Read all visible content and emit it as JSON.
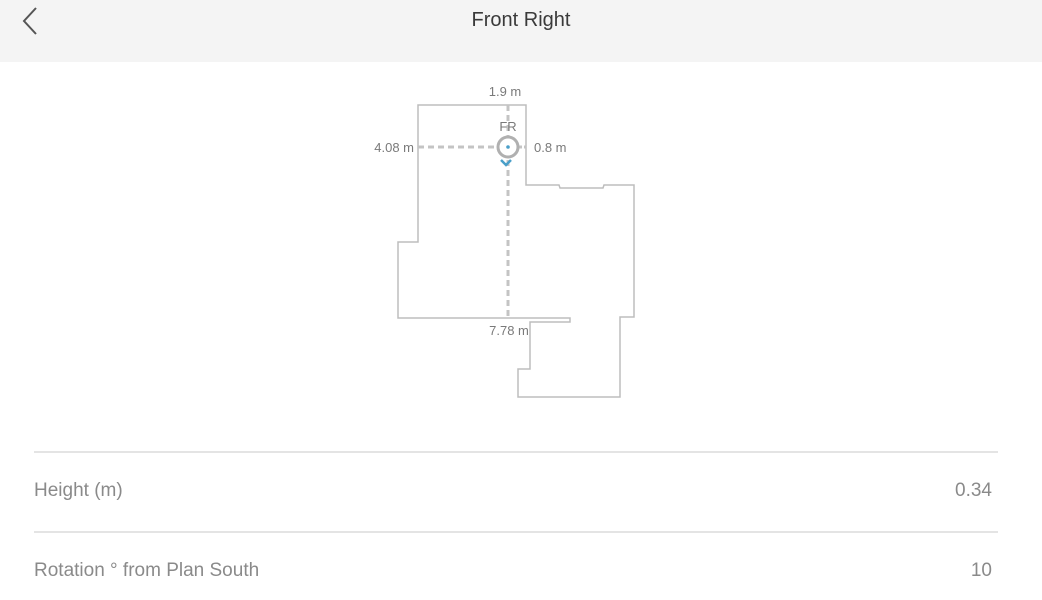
{
  "header": {
    "title": "Front Right",
    "back_icon": "chevron-left-icon"
  },
  "plan": {
    "speaker_label": "FR",
    "dist_top": "1.9 m",
    "dist_left": "4.08 m",
    "dist_right": "0.8 m",
    "dist_bottom": "7.78 m",
    "marker_color": "#4a9fc9"
  },
  "settings": [
    {
      "label": "Height (m)",
      "value": "0.34"
    },
    {
      "label": "Rotation ° from Plan South",
      "value": "10"
    }
  ]
}
